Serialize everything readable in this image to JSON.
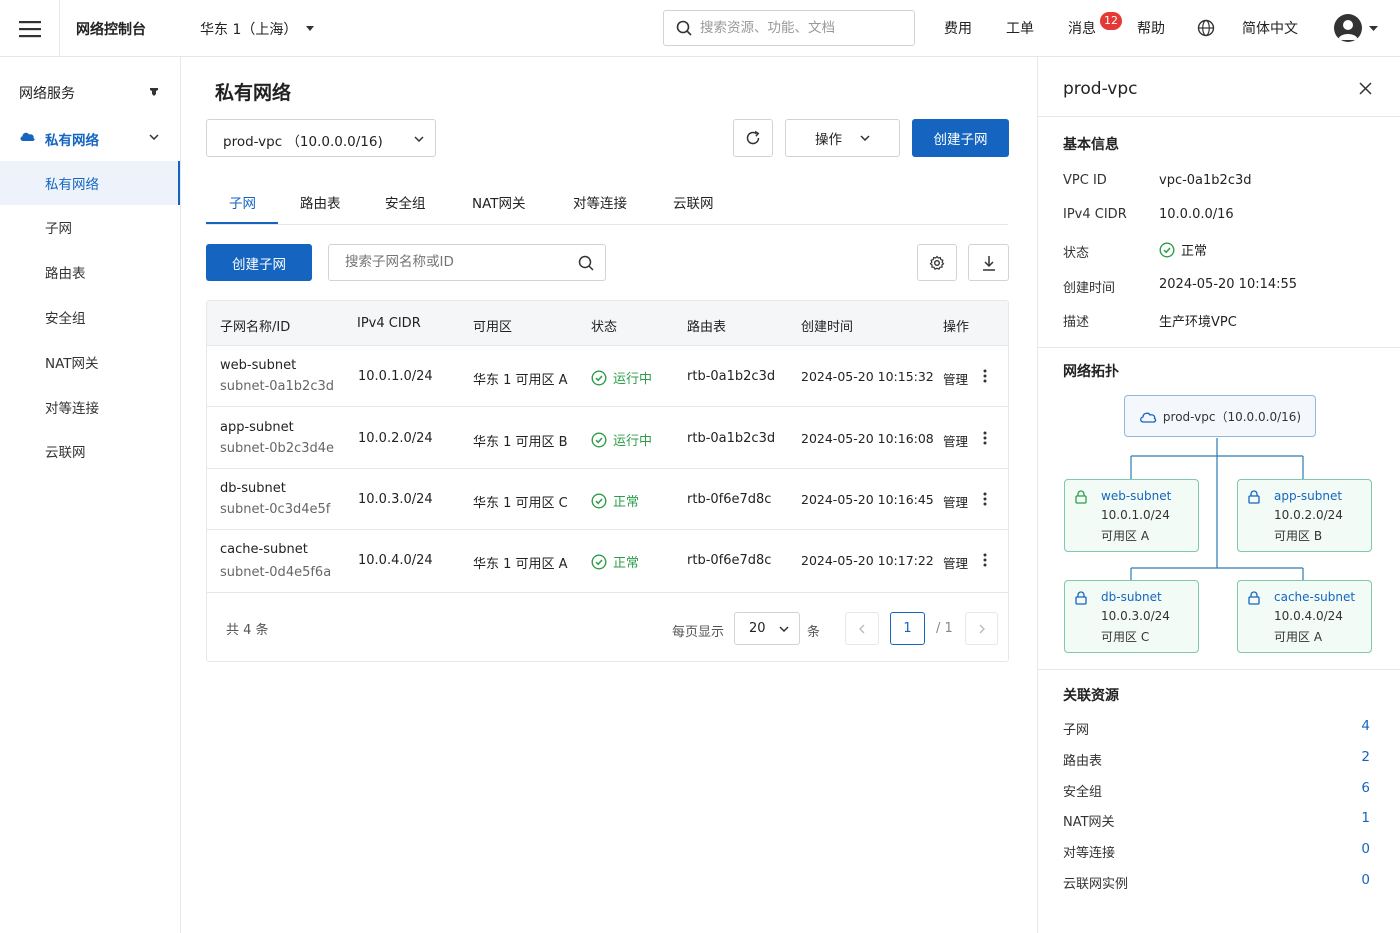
{
  "header": {
    "console_title": "网络控制台",
    "region": "华东 1（上海）",
    "search_placeholder": "搜索资源、功能、文档",
    "links": {
      "billing": "费用",
      "tickets": "工单",
      "messages": "消息",
      "help": "帮助",
      "language": "简体中文"
    },
    "message_count": "12"
  },
  "sidebar": {
    "section_title": "网络服务",
    "group_label": "私有网络",
    "items": [
      "私有网络",
      "子网",
      "路由表",
      "安全组",
      "NAT网关",
      "对等连接",
      "云联网"
    ]
  },
  "main": {
    "page_title": "私有网络",
    "vpc_select": "prod-vpc （10.0.0.0/16)",
    "ops_label": "操作",
    "create_subnet_top": "创建子网",
    "tabs": [
      "子网",
      "路由表",
      "安全组",
      "NAT网关",
      "对等连接",
      "云联网"
    ],
    "create_subnet": "创建子网",
    "subnet_search_placeholder": "搜索子网名称或ID",
    "columns": [
      "子网名称/ID",
      "IPv4 CIDR",
      "可用区",
      "状态",
      "路由表",
      "创建时间",
      "操作"
    ],
    "rows": [
      {
        "name": "web-subnet",
        "id": "subnet-0a1b2c3d",
        "cidr": "10.0.1.0/24",
        "zone": "华东 1 可用区 A",
        "status": "运行中",
        "rtb": "rtb-0a1b2c3d",
        "created": "2024-05-20 10:15:32",
        "action": "管理"
      },
      {
        "name": "app-subnet",
        "id": "subnet-0b2c3d4e",
        "cidr": "10.0.2.0/24",
        "zone": "华东 1 可用区 B",
        "status": "运行中",
        "rtb": "rtb-0a1b2c3d",
        "created": "2024-05-20 10:16:08",
        "action": "管理"
      },
      {
        "name": "db-subnet",
        "id": "subnet-0c3d4e5f",
        "cidr": "10.0.3.0/24",
        "zone": "华东 1 可用区 C",
        "status": "正常",
        "rtb": "rtb-0f6e7d8c",
        "created": "2024-05-20 10:16:45",
        "action": "管理"
      },
      {
        "name": "cache-subnet",
        "id": "subnet-0d4e5f6a",
        "cidr": "10.0.4.0/24",
        "zone": "华东 1 可用区 A",
        "status": "正常",
        "rtb": "rtb-0f6e7d8c",
        "created": "2024-05-20 10:17:22",
        "action": "管理"
      }
    ],
    "pagination": {
      "total": "共 4 条",
      "per_page_label": "每页显示",
      "page_size": "20",
      "unit": "条",
      "current_page": "1",
      "total_pages": "/ 1"
    }
  },
  "panel": {
    "title": "prod-vpc",
    "basic_title": "基本信息",
    "basic": [
      {
        "label": "VPC ID",
        "value": "vpc-0a1b2c3d"
      },
      {
        "label": "IPv4 CIDR",
        "value": "10.0.0.0/16"
      },
      {
        "label": "状态",
        "value": "正常"
      },
      {
        "label": "创建时间",
        "value": "2024-05-20 10:14:55"
      },
      {
        "label": "描述",
        "value": "生产环境VPC"
      }
    ],
    "topology_title": "网络拓扑",
    "topology_root": "prod-vpc（10.0.0.0/16)",
    "topology_nodes": [
      {
        "name": "web-subnet",
        "cidr": "10.0.1.0/24",
        "zone": "可用区 A"
      },
      {
        "name": "app-subnet",
        "cidr": "10.0.2.0/24",
        "zone": "可用区 B"
      },
      {
        "name": "db-subnet",
        "cidr": "10.0.3.0/24",
        "zone": "可用区 C"
      },
      {
        "name": "cache-subnet",
        "cidr": "10.0.4.0/24",
        "zone": "可用区 A"
      }
    ],
    "related_title": "关联资源",
    "related": [
      {
        "label": "子网",
        "count": "4"
      },
      {
        "label": "路由表",
        "count": "2"
      },
      {
        "label": "安全组",
        "count": "6"
      },
      {
        "label": "NAT网关",
        "count": "1"
      },
      {
        "label": "对等连接",
        "count": "0"
      },
      {
        "label": "云联网实例",
        "count": "0"
      }
    ]
  },
  "colors": {
    "primary": "#1565c0",
    "success": "#2e9d4a",
    "badge": "#e53935",
    "node_border": "#7fc8a9"
  },
  "icons": [
    "menu-icon",
    "caret-down-icon",
    "search-icon",
    "globe-icon",
    "user-avatar-icon",
    "pin-icon",
    "cloud-icon",
    "chevron-down-icon",
    "refresh-icon",
    "settings-icon",
    "download-icon",
    "check-circle-icon",
    "more-vertical-icon",
    "chevron-left-icon",
    "chevron-right-icon",
    "close-icon",
    "lock-icon"
  ]
}
